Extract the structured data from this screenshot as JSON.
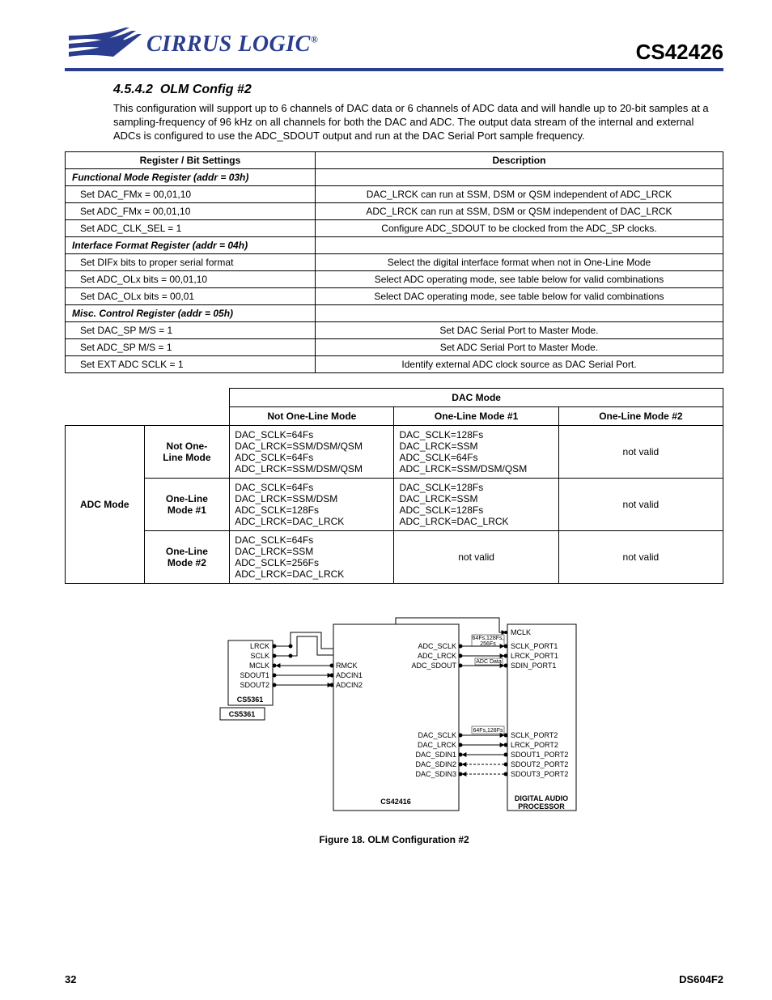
{
  "header": {
    "logo_text": "CIRRUS LOGIC",
    "reg_mark": "®",
    "part_number": "CS42426"
  },
  "section": {
    "number": "4.5.4.2",
    "title": "OLM Config #2",
    "paragraph": "This configuration will support up to 6 channels of DAC data or 6 channels of ADC data and will handle up to 20-bit samples at a sampling-frequency of 96 kHz on all channels for both the DAC and ADC. The output data stream of the internal and external ADCs is configured to use the ADC_SDOUT output and run at the DAC Serial Port sample frequency."
  },
  "table1": {
    "headers": [
      "Register / Bit Settings",
      "Description"
    ],
    "groups": [
      {
        "sub": "Functional Mode Register (addr = 03h)",
        "rows": [
          [
            "Set DAC_FMx = 00,01,10",
            "DAC_LRCK can run at SSM, DSM or QSM independent of ADC_LRCK"
          ],
          [
            "Set ADC_FMx = 00,01,10",
            "ADC_LRCK can run at SSM, DSM or QSM independent of DAC_LRCK"
          ],
          [
            "Set ADC_CLK_SEL = 1",
            "Configure ADC_SDOUT to be clocked from the ADC_SP clocks."
          ]
        ]
      },
      {
        "sub": "Interface Format Register (addr = 04h)",
        "rows": [
          [
            "Set DIFx bits to proper serial format",
            "Select the digital interface format when not in One-Line Mode"
          ],
          [
            "Set ADC_OLx bits = 00,01,10",
            "Select ADC operating mode, see table below for valid combinations"
          ],
          [
            "Set DAC_OLx bits = 00,01",
            "Select DAC operating mode, see table below for valid combinations"
          ]
        ]
      },
      {
        "sub": "Misc. Control Register (addr = 05h)",
        "rows": [
          [
            "Set DAC_SP M/S = 1",
            "Set DAC Serial Port to Master Mode."
          ],
          [
            "Set ADC_SP M/S = 1",
            "Set ADC Serial Port to Master Mode."
          ],
          [
            "Set EXT ADC SCLK = 1",
            "Identify external ADC clock source as DAC Serial Port."
          ]
        ]
      }
    ]
  },
  "table2": {
    "super_header": "DAC Mode",
    "col_headers": [
      "Not One-Line Mode",
      "One-Line Mode #1",
      "One-Line Mode #2"
    ],
    "row_group_label": "ADC Mode",
    "rows": [
      {
        "label": "Not One-Line Mode",
        "cells": [
          "DAC_SCLK=64Fs\nDAC_LRCK=SSM/DSM/QSM\nADC_SCLK=64Fs\nADC_LRCK=SSM/DSM/QSM",
          "DAC_SCLK=128Fs\nDAC_LRCK=SSM\nADC_SCLK=64Fs\nADC_LRCK=SSM/DSM/QSM",
          "not valid"
        ]
      },
      {
        "label": "One-Line Mode #1",
        "cells": [
          "DAC_SCLK=64Fs\nDAC_LRCK=SSM/DSM\nADC_SCLK=128Fs\nADC_LRCK=DAC_LRCK",
          "DAC_SCLK=128Fs\nDAC_LRCK=SSM\nADC_SCLK=128Fs\nADC_LRCK=DAC_LRCK",
          "not valid"
        ]
      },
      {
        "label": "One-Line Mode #2",
        "cells": [
          "DAC_SCLK=64Fs\nDAC_LRCK=SSM\nADC_SCLK=256Fs\nADC_LRCK=DAC_LRCK",
          "not valid",
          "not valid"
        ]
      }
    ]
  },
  "diagram": {
    "left_block_top": "CS5361",
    "left_block_bot": "CS5361",
    "center_block": "CS42416",
    "right_block_line1": "DIGITAL AUDIO",
    "right_block_line2": "PROCESSOR",
    "left_signals": [
      "LRCK",
      "SCLK",
      "MCLK",
      "SDOUT1",
      "SDOUT2"
    ],
    "mid_left_signals": [
      "RMCK",
      "ADCIN1",
      "ADCIN2"
    ],
    "adc_signals": [
      "ADC_SCLK",
      "ADC_LRCK",
      "ADC_SDOUT"
    ],
    "adc_note_lines": [
      "64Fs,128Fs,",
      "256Fs"
    ],
    "adc_data_note": "ADC Data",
    "dac_signals": [
      "DAC_SCLK",
      "DAC_LRCK",
      "DAC_SDIN1",
      "DAC_SDIN2",
      "DAC_SDIN3"
    ],
    "dac_note": "64Fs,128Fs",
    "right_top_signal": "MCLK",
    "right_port1": [
      "SCLK_PORT1",
      "LRCK_PORT1",
      "SDIN_PORT1"
    ],
    "right_port2": [
      "SCLK_PORT2",
      "LRCK_PORT2",
      "SDOUT1_PORT2",
      "SDOUT2_PORT2",
      "SDOUT3_PORT2"
    ],
    "caption": "Figure 18.  OLM Configuration #2"
  },
  "footer": {
    "page": "32",
    "doc_id": "DS604F2"
  }
}
